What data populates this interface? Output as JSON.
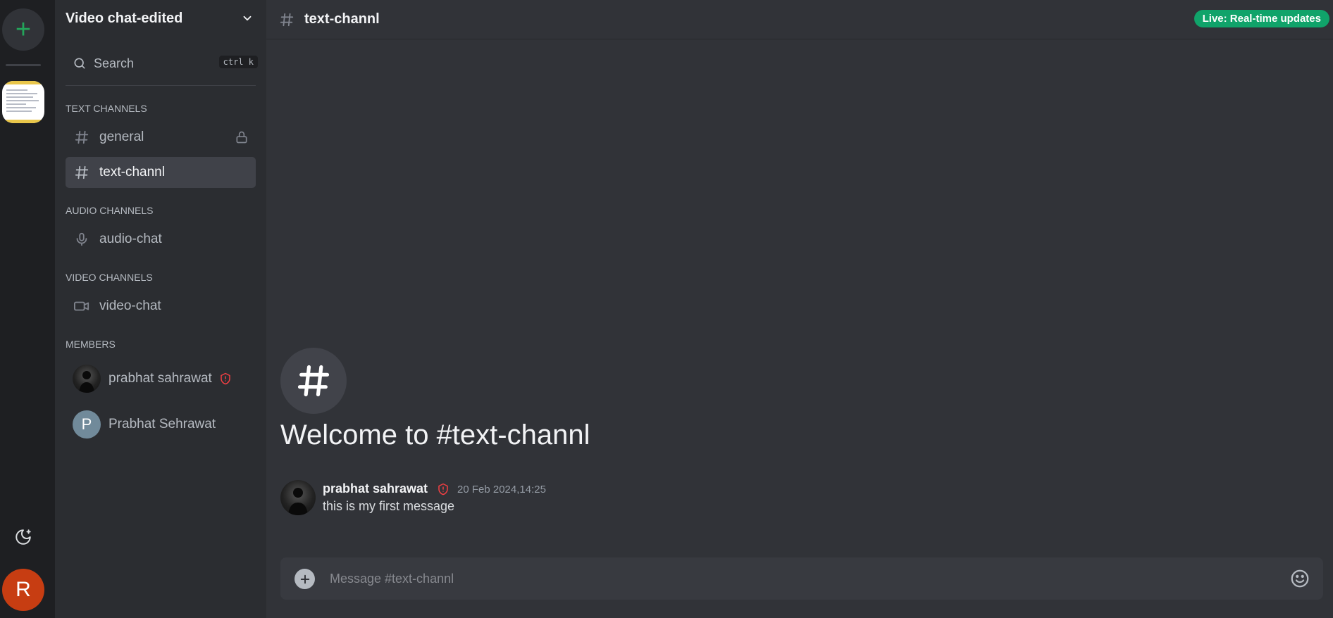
{
  "rail": {
    "add_server_label": "+",
    "user_initial": "R",
    "icons": {
      "add": "plus-icon",
      "theme": "moon-stars-icon"
    }
  },
  "server": {
    "name": "Video chat-edited"
  },
  "search": {
    "label": "Search",
    "shortcut_ctrl": "ctrl",
    "shortcut_key": "k"
  },
  "sections": {
    "text": "TEXT CHANNELS",
    "audio": "AUDIO CHANNELS",
    "video": "VIDEO CHANNELS",
    "members": "MEMBERS"
  },
  "channels": {
    "text": [
      {
        "label": "general",
        "locked": true,
        "active": false
      },
      {
        "label": "text-channl",
        "locked": false,
        "active": true
      }
    ],
    "audio": [
      {
        "label": "audio-chat"
      }
    ],
    "video": [
      {
        "label": "video-chat"
      }
    ]
  },
  "members": [
    {
      "name": "prabhat sahrawat",
      "role_icon": "shield-alert-icon",
      "avatar": "photo"
    },
    {
      "name": "Prabhat Sehrawat",
      "avatar_letter": "P"
    }
  ],
  "topbar": {
    "channel": "text-channl",
    "live_badge": "Live: Real-time updates"
  },
  "welcome": {
    "title": "Welcome to #text-channl",
    "glyph": "#"
  },
  "messages": [
    {
      "author": "prabhat sahrawat",
      "timestamp": "20 Feb 2024,14:25",
      "text": "this is my first message"
    }
  ],
  "composer": {
    "placeholder": "Message #text-channl"
  },
  "colors": {
    "accent_green": "#23a55a",
    "live_green": "#10a36a",
    "mod_red": "#f23f43",
    "user_avatar": "#c73d12"
  }
}
